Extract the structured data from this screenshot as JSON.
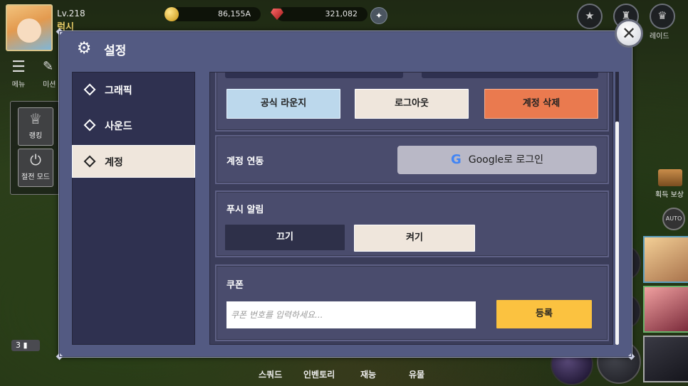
{
  "hud": {
    "level": "Lv.218",
    "player_name": "럭시",
    "gold": "86,155A",
    "gems": "321,082",
    "raid_label": "레이드"
  },
  "left_menu": {
    "menu_label": "메뉴",
    "mission_label": "미션",
    "ranking_label": "랭킹",
    "power_save_label": "절전 모드",
    "camera_count": "3"
  },
  "right_hud": {
    "reward_label": "획득 보상",
    "auto_label": "AUTO"
  },
  "bottom_nav": {
    "squad": "스쿼드",
    "inventory": "인벤토리",
    "talent": "재능",
    "relic": "유물"
  },
  "modal": {
    "title": "설정",
    "tabs": [
      {
        "label": "그래픽",
        "active": false
      },
      {
        "label": "사운드",
        "active": false
      },
      {
        "label": "계정",
        "active": true
      }
    ],
    "account_buttons": {
      "lounge": "공식 라운지",
      "logout": "로그아웃",
      "delete": "계정 삭제"
    },
    "link": {
      "title": "계정 연동",
      "google_logo": "G",
      "google_button": "Google로 로그인"
    },
    "push": {
      "title": "푸시 알림",
      "off": "끄기",
      "on": "켜기",
      "selected": "on"
    },
    "coupon": {
      "title": "쿠폰",
      "placeholder": "쿠폰 번호를 입력하세요...",
      "value": "",
      "submit": "등록"
    }
  },
  "colors": {
    "modal_bg": "#535a82",
    "panel_bg": "#2f3150",
    "accent_red": "#ea7a4f",
    "accent_yellow": "#fbc240",
    "accent_blue": "#bcd8ec",
    "cream": "#efe6dc"
  }
}
